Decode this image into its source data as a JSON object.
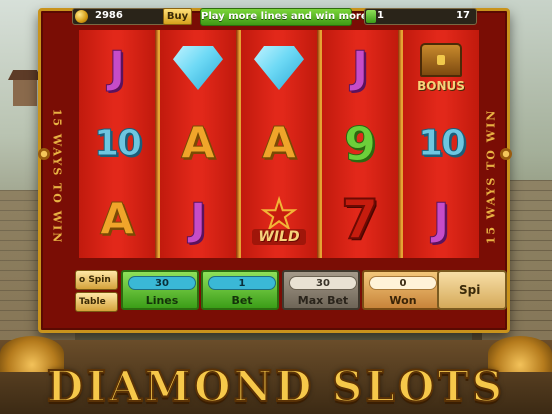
{
  "game": {
    "title": "DIAMOND SLOTS",
    "side_text": "15 WAYS TO WIN"
  },
  "topbar": {
    "coins": "2986",
    "buy_label": "Buy",
    "promo": "Play more lines and win more!",
    "level": "1",
    "level_max": "17",
    "level_progress": 0.06
  },
  "reels": [
    [
      "J",
      "10",
      "A"
    ],
    [
      "diamond",
      "A",
      "J"
    ],
    [
      "diamond",
      "A",
      "wild"
    ],
    [
      "J",
      "9",
      "7"
    ],
    [
      "bonus",
      "10",
      "J"
    ]
  ],
  "symbols": {
    "wild_label": "WILD",
    "bonus_label": "BONUS"
  },
  "controls": {
    "auto_spin_label": "o Spin",
    "paytable_label": "Table",
    "lines_value": "30",
    "lines_label": "Lines",
    "bet_value": "1",
    "bet_label": "Bet",
    "max_bet_value": "30",
    "max_bet_label": "Max Bet",
    "won_value": "0",
    "won_label": "Won",
    "spin_label": "Spi"
  },
  "colors": {
    "cabinet": "#7a0d05",
    "frame_gold": "#c9931c",
    "lines_bet_green": "#3b9d18",
    "title_gold": "#f6c84a"
  }
}
